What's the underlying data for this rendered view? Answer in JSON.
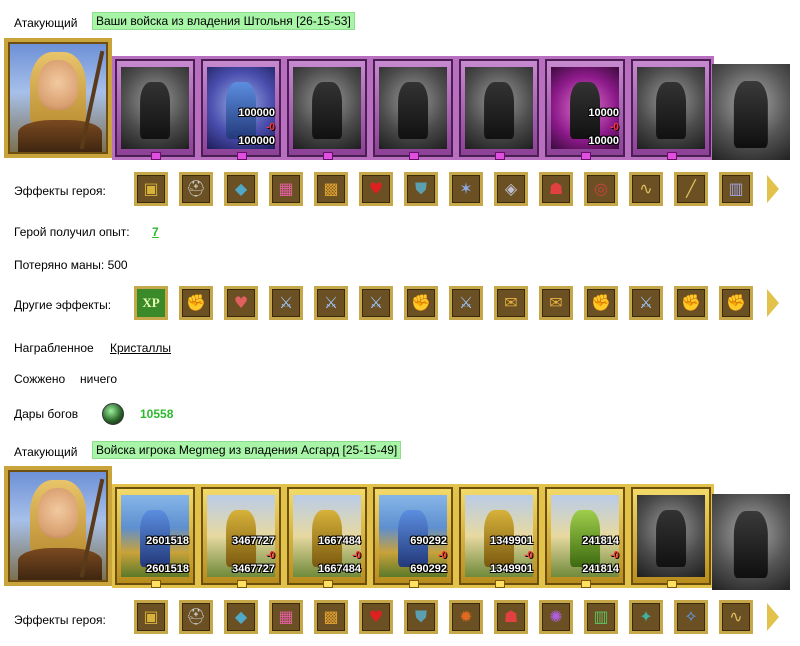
{
  "colors": {
    "highlight": "#a8f5a8",
    "green_value": "#2eb82e",
    "frame_gold": "#c6a84a",
    "frame_purple": "#b86fc0",
    "loss_red": "#ff3333"
  },
  "section1": {
    "role_label": "Атакующий",
    "army_title": "Ваши войска из владения Штольня [26-15-53]",
    "units": [
      {
        "count_top": "",
        "loss": "",
        "count_bottom": ""
      },
      {
        "count_top": "100000",
        "loss": "-0",
        "count_bottom": "100000"
      },
      {
        "count_top": "",
        "loss": "",
        "count_bottom": ""
      },
      {
        "count_top": "",
        "loss": "",
        "count_bottom": ""
      },
      {
        "count_top": "",
        "loss": "",
        "count_bottom": ""
      },
      {
        "count_top": "10000",
        "loss": "-0",
        "count_bottom": "10000"
      },
      {
        "count_top": "",
        "loss": "",
        "count_bottom": ""
      }
    ],
    "hero_effects_label": "Эффекты героя:",
    "hero_effects_icons": [
      "chest-icon",
      "helmet-icon",
      "boots-icon",
      "gift-icon",
      "treasure-icon",
      "heart-icon",
      "shield-icon",
      "claw-icon",
      "amulet-icon",
      "mask-icon",
      "ring-icon",
      "whip-icon",
      "staff-icon",
      "armor-icon"
    ],
    "exp_label": "Герой получил опыт:",
    "exp_value": "7",
    "mana_text": "Потеряно маны: 500",
    "other_effects_label": "Другие эффекты:",
    "other_effects_icons": [
      "xp-icon",
      "fist-sword-icon",
      "heart-sword-icon",
      "sword-icon",
      "sword-icon",
      "sword-icon",
      "fist-sword-icon",
      "sword-icon",
      "scroll-icon",
      "scroll-icon",
      "fist-sword-icon",
      "sword-icon",
      "fist-sword-icon",
      "fist-sword-icon"
    ],
    "xp_glyph": "XP",
    "loot_label": "Награбленное",
    "loot_value": "Кристаллы",
    "burned_label": "Сожжено",
    "burned_value": "ничего",
    "gifts_label": "Дары богов",
    "gifts_value": "10558"
  },
  "section2": {
    "role_label": "Атакующий",
    "army_title": "Войска игрока Megmeg из владения Асгард [25-15-49]",
    "units": [
      {
        "count_top": "2601518",
        "loss": "",
        "count_bottom": "2601518"
      },
      {
        "count_top": "3467727",
        "loss": "-0",
        "count_bottom": "3467727"
      },
      {
        "count_top": "1667484",
        "loss": "-0",
        "count_bottom": "1667484"
      },
      {
        "count_top": "690292",
        "loss": "-0",
        "count_bottom": "690292"
      },
      {
        "count_top": "1349901",
        "loss": "-0",
        "count_bottom": "1349901"
      },
      {
        "count_top": "241814",
        "loss": "-0",
        "count_bottom": "241814"
      },
      {
        "count_top": "",
        "loss": "",
        "count_bottom": ""
      }
    ],
    "hero_effects_label": "Эффекты героя:",
    "hero_effects_icons": [
      "chest-icon",
      "helmet-icon",
      "boots-icon",
      "gift-icon",
      "treasure-icon",
      "heart-icon",
      "shield-icon",
      "flame-icon",
      "mask-icon",
      "beast-icon",
      "armor-green-icon",
      "rune-icon",
      "crystal-icon",
      "whip-icon"
    ]
  }
}
